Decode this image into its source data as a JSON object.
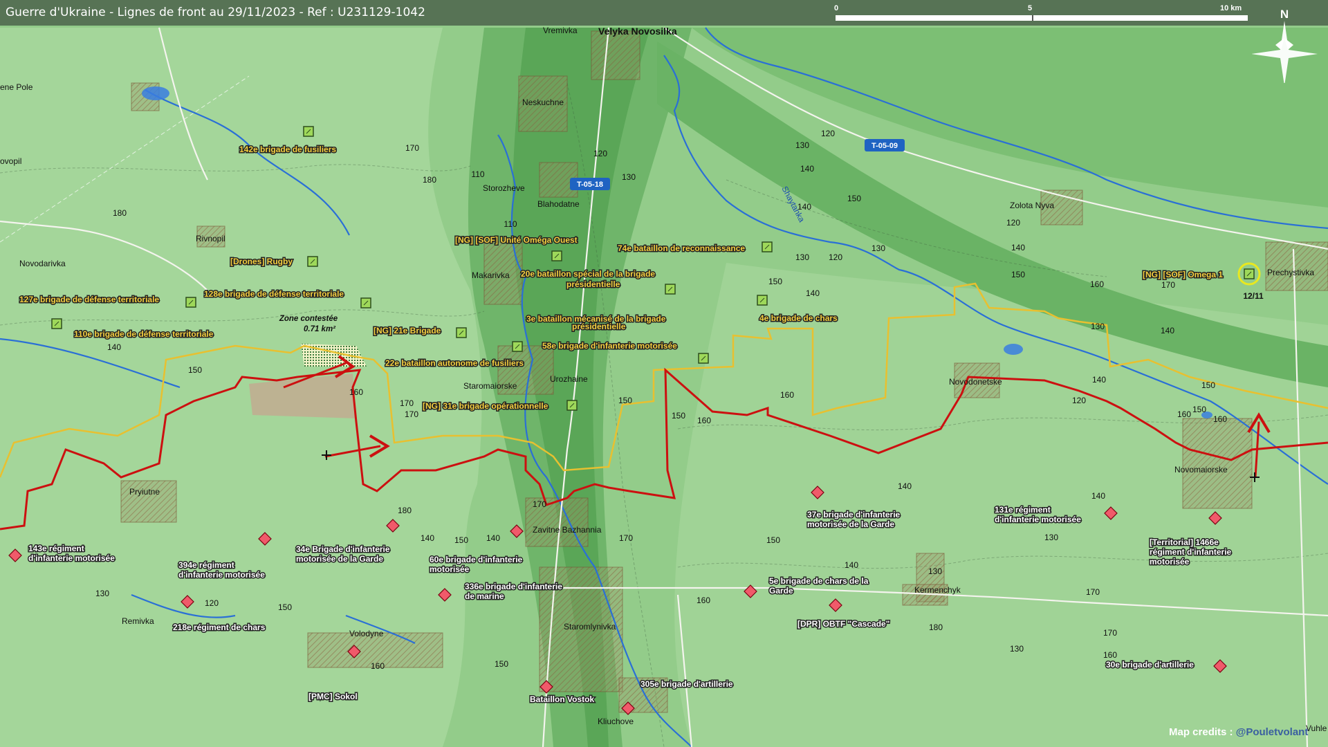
{
  "header": {
    "title": "Guerre d'Ukraine - Lignes de front au 29/11/2023 - Ref : U231129-1042",
    "scale_labels": [
      "0",
      "5",
      "10 km"
    ],
    "north_label": "N"
  },
  "roads": [
    {
      "label": "T-05-18"
    },
    {
      "label": "T-05-09"
    }
  ],
  "river_label": "Shaytanka",
  "places": [
    {
      "name": "Velyka Novosilka",
      "bold": true
    },
    {
      "name": "Vremivka"
    },
    {
      "name": "Neskuchne"
    },
    {
      "name": "Storozheve"
    },
    {
      "name": "Blahodatne"
    },
    {
      "name": "Makarivka"
    },
    {
      "name": "Staromaiorske"
    },
    {
      "name": "Urozhaine"
    },
    {
      "name": "Zavitne Bazhannia"
    },
    {
      "name": "Staromlynivka"
    },
    {
      "name": "Kliuchove"
    },
    {
      "name": "Rivnopil"
    },
    {
      "name": "Novodarivka"
    },
    {
      "name": "Pryiutne"
    },
    {
      "name": "Remivka"
    },
    {
      "name": "Volodyne"
    },
    {
      "name": "Zolota Nyva"
    },
    {
      "name": "Prechystivka"
    },
    {
      "name": "Novodonetske"
    },
    {
      "name": "Novomaiorske"
    },
    {
      "name": "Kermenchyk"
    },
    {
      "name": "ene Pole"
    },
    {
      "name": "ovopil"
    },
    {
      "name": "Vuhle"
    }
  ],
  "elevations": [
    "170",
    "180",
    "180",
    "120",
    "130",
    "110",
    "110",
    "120",
    "130",
    "140",
    "150",
    "140",
    "130",
    "120",
    "150",
    "140",
    "130",
    "120",
    "140",
    "150",
    "130",
    "140",
    "150",
    "160",
    "150",
    "140",
    "170",
    "160",
    "160",
    "170",
    "180",
    "160",
    "150",
    "140",
    "130",
    "120",
    "150",
    "140",
    "170",
    "150",
    "140",
    "130",
    "140",
    "150",
    "160",
    "170",
    "160",
    "150",
    "140",
    "130",
    "120",
    "160",
    "170",
    "180",
    "160",
    "130",
    "140",
    "150",
    "170",
    "150",
    "160",
    "170"
  ],
  "ukr_units": [
    {
      "label": "142e brigade de fusiliers"
    },
    {
      "label": "[Drones] Rugby"
    },
    {
      "label": "127e brigade de défense territoriale"
    },
    {
      "label": "128e brigade de défense territoriale"
    },
    {
      "label": "110e brigade de défense territoriale"
    },
    {
      "label": "[NG] 21e Brigade"
    },
    {
      "label": "[NG] [SOF] Unité Oméga Ouest"
    },
    {
      "label": "20e bataillon spécial de la brigade"
    },
    {
      "label": "présidentielle"
    },
    {
      "label": "3e bataillon mécanisé de la brigade"
    },
    {
      "label": "présidentielle"
    },
    {
      "label": "58e brigade d'infanterie motorisée"
    },
    {
      "label": "22e bataillon autonome de fusiliers"
    },
    {
      "label": "[NG] 31e brigade opérationnelle"
    },
    {
      "label": "74e bataillon de reconnaissance"
    },
    {
      "label": "4e brigade de chars"
    },
    {
      "label": "[NG] [SOF] Omega 1"
    }
  ],
  "omega_date": "12/11",
  "rus_units": [
    {
      "label": "143e régiment"
    },
    {
      "label": "d'infanterie motorisée"
    },
    {
      "label": "394e régiment"
    },
    {
      "label": "d'infanterie motorisée"
    },
    {
      "label": "218e régiment de chars"
    },
    {
      "label": "34e Brigade d'infanterie"
    },
    {
      "label": "motorisée de la Garde"
    },
    {
      "label": "[PMC] Sokol"
    },
    {
      "label": "60e brigade d'infanterie"
    },
    {
      "label": "motorisée"
    },
    {
      "label": "336e brigade d'infanterie"
    },
    {
      "label": "de marine"
    },
    {
      "label": "Bataillon Vostok"
    },
    {
      "label": "305e brigade d'artillerie"
    },
    {
      "label": "37e brigade d'infanterie"
    },
    {
      "label": "motorisée de la Garde"
    },
    {
      "label": "5e brigade de chars de la"
    },
    {
      "label": "Garde"
    },
    {
      "label": "[DPR] OBTF \"Cascade\""
    },
    {
      "label": "131e régiment"
    },
    {
      "label": "d'infanterie motorisée"
    },
    {
      "label": "[Territorial] 1466e"
    },
    {
      "label": "régiment d'infanterie"
    },
    {
      "label": "motorisée"
    },
    {
      "label": "30e brigade d'artillerie"
    }
  ],
  "contested": {
    "line1": "Zone contestée",
    "line2": "0.71 km²"
  },
  "credits": {
    "prefix": "Map credits : ",
    "handle": "@Pouletvolant"
  },
  "colors": {
    "front_ukr": "#e8c030",
    "front_rus": "#cc1010",
    "ukr_unit_text": "#f5d040",
    "rus_unit_text": "#ffffff",
    "river": "#2a6fd6",
    "road_shield": "#1f63c2"
  }
}
